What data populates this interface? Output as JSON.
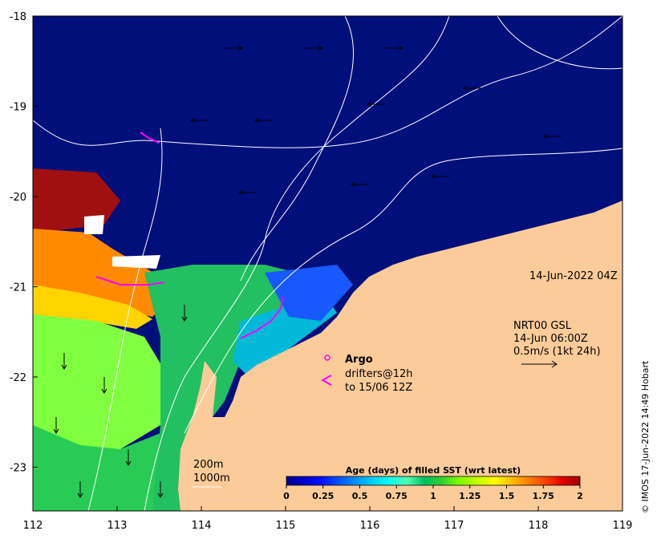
{
  "map": {
    "x_ticks": [
      "112",
      "113",
      "114",
      "115",
      "116",
      "117",
      "118",
      "119"
    ],
    "y_ticks": [
      "-18",
      "-19",
      "-20",
      "-21",
      "-22",
      "-23"
    ],
    "land_color": "#fccb9a",
    "ocean_deep_color": "#000f7a"
  },
  "annotations": {
    "date_label": "14-Jun-2022 04Z",
    "current_model": "NRT00 GSL",
    "current_time": "14-Jun 06:00Z",
    "current_scale": "0.5m/s (1kt 24h)",
    "argo_label": "Argo",
    "drifters_label": "drifters@12h",
    "drifters_until": "to 15/06 12Z",
    "drifter_glyph": "<",
    "argo_glyph": "o",
    "isobath_200": "200m",
    "isobath_1000": "1000m",
    "credit": "© IMOS 17-Jun-2022 14:49 Hobart"
  },
  "colorbar": {
    "title": "Age (days) of filled SST (wrt latest)",
    "tick_labels": [
      "0",
      "0.25",
      "0.5",
      "0.75",
      "1",
      "1.25",
      "1.5",
      "1.75",
      "2"
    ],
    "colors": [
      "#00008f",
      "#0000c8",
      "#0010ff",
      "#0050ff",
      "#0090ff",
      "#00cfff",
      "#10ffef",
      "#50ffaf",
      "#00c060",
      "#30d030",
      "#80ff00",
      "#c0ff00",
      "#ffff00",
      "#ffc000",
      "#ff8000",
      "#ff4000",
      "#e00000",
      "#a00000"
    ],
    "range": [
      0,
      2
    ]
  },
  "palette": {
    "argo": "#ff00ff",
    "drifter": "#ff00ff",
    "contour": "#ffffff",
    "arrow": "#000000"
  }
}
